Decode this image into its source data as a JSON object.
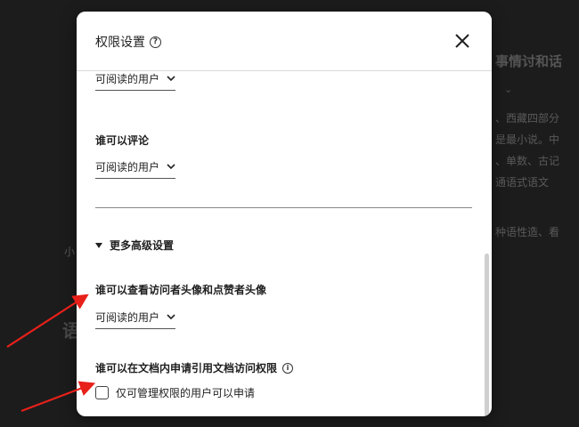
{
  "background": {
    "title_fragment": "事情讨和话",
    "lines": [
      "、西藏四部分",
      "是最小说。中",
      "、单数、古记",
      "通语式语文"
    ],
    "lower_text": "种语性造、看",
    "left_char": "小",
    "big_char": "语"
  },
  "modal": {
    "title": "权限设置",
    "help_glyph": "?",
    "selects": {
      "top": "可阅读的用户",
      "comment": "可阅读的用户",
      "avatar": "可阅读的用户"
    },
    "labels": {
      "comment": "谁可以评论",
      "avatar": "谁可以查看访问者头像和点赞者头像",
      "request": "谁可以在文档内申请引用文档访问权限"
    },
    "advanced_label": "更多高级设置",
    "info_glyph": "i",
    "checkbox_label": "仅可管理权限的用户可以申请",
    "checkbox_checked": false
  },
  "colors": {
    "accent_arrow": "#e8201a",
    "modal_bg": "#ffffff",
    "overlay_bg": "#1b1b1b"
  }
}
